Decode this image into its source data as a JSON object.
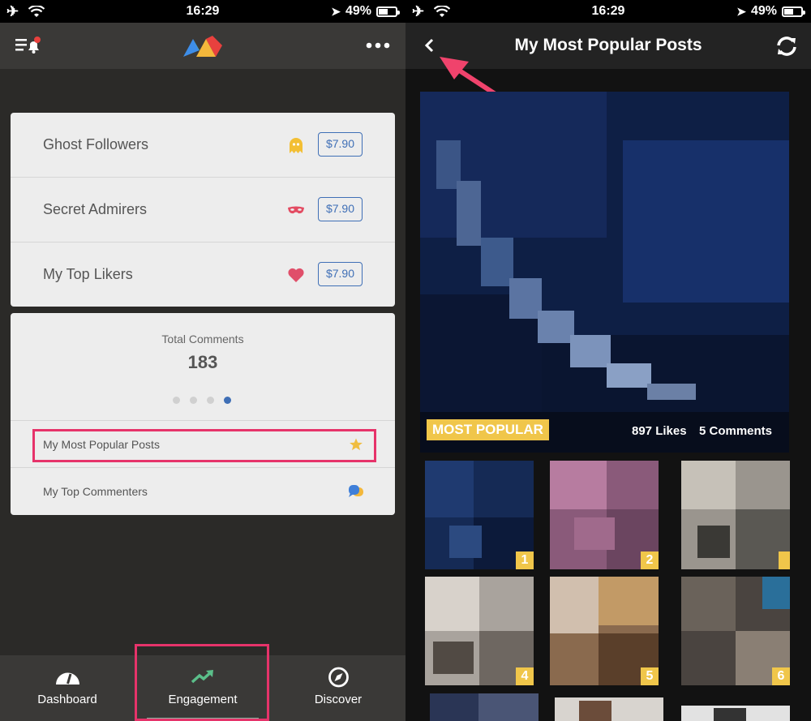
{
  "status": {
    "time": "16:29",
    "battery": "49%",
    "battery_level": 0.49
  },
  "left": {
    "nav": {
      "menu_icon": "menu-bell-icon",
      "logo": "app-logo",
      "more_icon": "more-icon"
    },
    "reports": [
      {
        "label": "Ghost Followers",
        "icon": "ghost-icon",
        "price": "$7.90"
      },
      {
        "label": "Secret Admirers",
        "icon": "mask-icon",
        "price": "$7.90"
      },
      {
        "label": "My Top Likers",
        "icon": "heart-icon",
        "price": "$7.90"
      }
    ],
    "stats": {
      "title": "Total Comments",
      "value": "183",
      "pages": 4,
      "active_page": 4,
      "links": [
        {
          "label": "My Most Popular Posts",
          "icon": "star-icon"
        },
        {
          "label": "My Top Commenters",
          "icon": "chat-icon"
        }
      ]
    },
    "tabs": [
      {
        "label": "Dashboard",
        "icon": "speedometer-icon"
      },
      {
        "label": "Engagement",
        "icon": "trend-up-icon"
      },
      {
        "label": "Discover",
        "icon": "compass-icon"
      }
    ]
  },
  "right": {
    "nav": {
      "title": "My Most Popular Posts",
      "back_icon": "back-chevron-icon",
      "refresh_icon": "refresh-icon"
    },
    "hero": {
      "badge": "MOST POPULAR",
      "likes": "897 Likes",
      "comments": "5 Comments"
    },
    "thumbs": [
      "1",
      "2",
      "",
      "4",
      "5",
      "6"
    ]
  },
  "colors": {
    "accent": "#3f6fb6",
    "highlight": "#e6336a",
    "gold": "#f0c64a"
  }
}
